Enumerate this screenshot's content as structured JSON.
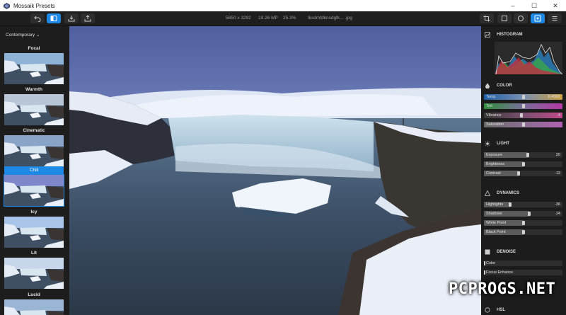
{
  "window": {
    "title": "Mossaik Presets",
    "minimize": "–",
    "maximize": "☐",
    "close": "✕"
  },
  "toolbar": {
    "left_buttons": [
      "undo-icon",
      "compare-icon",
      "import-icon",
      "export-icon"
    ],
    "info": {
      "dimensions": "5850 x 3292",
      "megapixels": "19.26 MP",
      "zoom": "25.3%",
      "filename": "Iksdmfdknsdgfk... .jpg"
    },
    "right_buttons": [
      "crop-icon",
      "square-icon",
      "circle-icon",
      "adjust-icon",
      "menu-icon"
    ],
    "active_right": "adjust-icon"
  },
  "presets": {
    "category": "Contemporary",
    "items": [
      {
        "label": "Focal",
        "active": false
      },
      {
        "label": "Warmth",
        "active": false
      },
      {
        "label": "Cinematic",
        "active": false
      },
      {
        "label": "Chill",
        "active": true
      },
      {
        "label": "Icy",
        "active": false
      },
      {
        "label": "Lit",
        "active": false
      },
      {
        "label": "Lucid",
        "active": false
      }
    ]
  },
  "panel": {
    "histogram": {
      "title": "HISTOGRAM"
    },
    "color": {
      "title": "COLOR",
      "sliders": [
        {
          "label": "Temp",
          "value": "6,456K",
          "style": "temp",
          "level": 0.5
        },
        {
          "label": "Tint",
          "value": "",
          "style": "tint",
          "level": 0.5
        },
        {
          "label": "Vibrance",
          "value": "-4",
          "style": "vibrance",
          "level": 0.48
        },
        {
          "label": "Saturation",
          "value": "",
          "style": "saturation",
          "level": 0.5
        }
      ]
    },
    "light": {
      "title": "LIGHT",
      "sliders": [
        {
          "label": "Exposure",
          "value": "20",
          "level": 0.56
        },
        {
          "label": "Brightness",
          "value": "",
          "level": 0.5
        },
        {
          "label": "Contrast",
          "value": "-13",
          "level": 0.44
        }
      ]
    },
    "dynamics": {
      "title": "DYNAMICS",
      "sliders": [
        {
          "label": "Highlights",
          "value": "-36",
          "level": 0.33
        },
        {
          "label": "Shadows",
          "value": "24",
          "level": 0.58
        },
        {
          "label": "White Point",
          "value": "",
          "level": 0.5
        },
        {
          "label": "Black Point",
          "value": "",
          "level": 0.5
        }
      ]
    },
    "denoise": {
      "title": "DENOISE",
      "sliders": [
        {
          "label": "Color",
          "value": "",
          "level": 0.0
        },
        {
          "label": "Focus Enhance",
          "value": "",
          "level": 0.0
        }
      ]
    },
    "hsl": {
      "title": "HSL"
    }
  },
  "watermark": "PCPROGS.NET",
  "colors": {
    "accent": "#1e88e5",
    "panel": "#1c1c1c"
  }
}
